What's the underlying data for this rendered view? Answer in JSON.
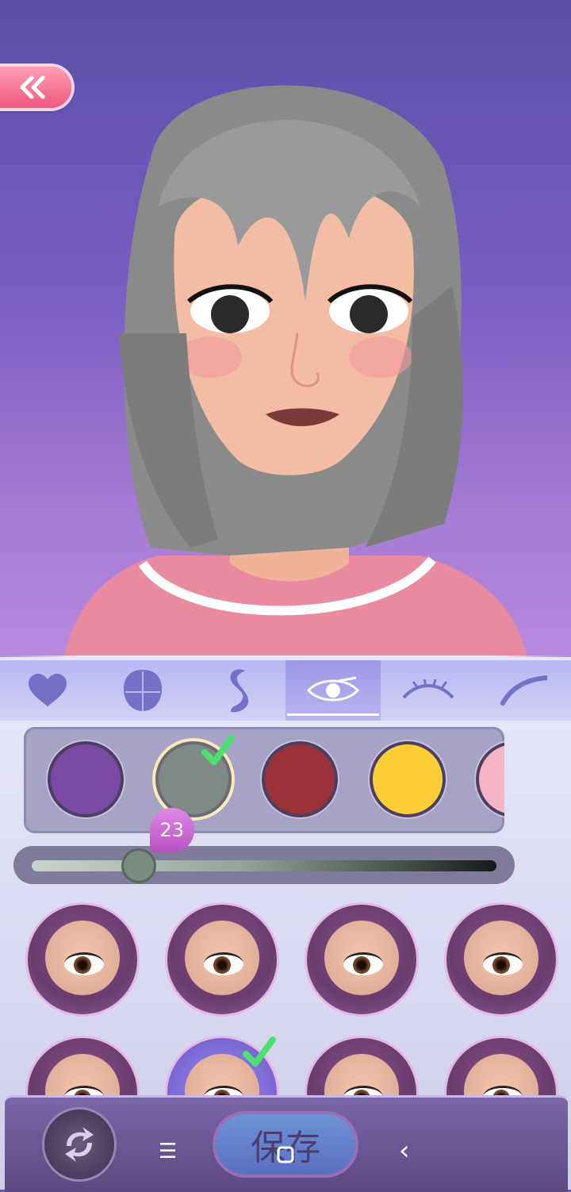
{
  "colors": {
    "swatches": [
      "#7a4aa3",
      "#7f8a86",
      "#9b3238",
      "#fcce35",
      "#f6b5c7"
    ],
    "selected_swatch_index": 1,
    "check": "#4ee06e"
  },
  "slider": {
    "value": 23,
    "value_label": "23"
  },
  "tabs": {
    "items": [
      "favorite-icon",
      "head-shape-icon",
      "hair-icon",
      "eye-icon",
      "eyebrow-icon",
      "eyelash-icon"
    ],
    "active_index": 3
  },
  "eye_styles": {
    "count_visible": 8,
    "selected_index": 5
  },
  "bottom_bar": {
    "save_label": "保存"
  },
  "system_nav": {
    "menu_glyph": "☰",
    "back_glyph": "‹"
  }
}
